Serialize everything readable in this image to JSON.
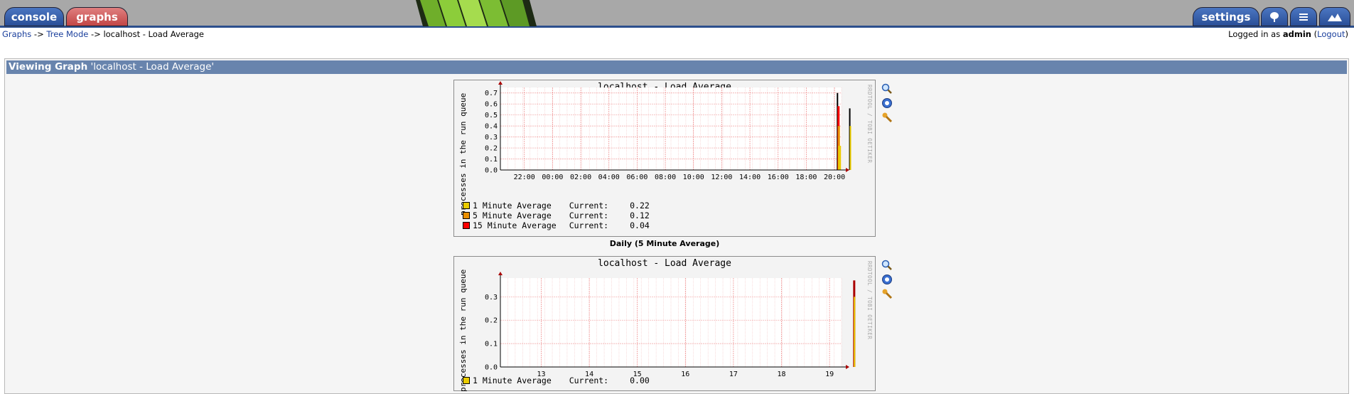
{
  "tabs": {
    "console": "console",
    "graphs": "graphs",
    "settings": "settings"
  },
  "breadcrumb": {
    "link1": "Graphs",
    "sep1": " -> ",
    "link2": "Tree Mode",
    "sep2": " -> ",
    "current": "localhost - Load Average"
  },
  "login": {
    "prefix": "Logged in as ",
    "user": "admin",
    "logout": "Logout"
  },
  "panel": {
    "heading_bold": "Viewing Graph",
    "heading_name": " 'localhost - Load Average'"
  },
  "graphs": [
    {
      "title": "localhost - Load Average",
      "ylabel": "processes in the run queue",
      "rrd": "RRDTOOL / TOBI OETIKER",
      "caption": "Daily (5 Minute Average)",
      "legend": [
        {
          "name": "1 Minute Average ",
          "label": "Current:",
          "value": "0.22",
          "color": "#eacc00"
        },
        {
          "name": "5 Minute Average ",
          "label": "Current:",
          "value": "0.12",
          "color": "#ea8f00"
        },
        {
          "name": "15 Minute Average",
          "label": "Current:",
          "value": "0.04",
          "color": "#ff0000"
        }
      ],
      "chart_data": {
        "type": "area",
        "title": "localhost - Load Average",
        "ylabel": "processes in the run queue",
        "x_ticks": [
          "22:00",
          "00:00",
          "02:00",
          "04:00",
          "06:00",
          "08:00",
          "10:00",
          "12:00",
          "14:00",
          "16:00",
          "18:00",
          "20:00"
        ],
        "y_ticks": [
          "0.0",
          "0.1",
          "0.2",
          "0.3",
          "0.4",
          "0.5",
          "0.6",
          "0.7"
        ],
        "ylim": [
          0,
          0.75
        ]
      }
    },
    {
      "title": "localhost - Load Average",
      "ylabel": "processes in the run queue",
      "rrd": "RRDTOOL / TOBI OETIKER",
      "legend": [
        {
          "name": "1 Minute Average ",
          "label": "Current:",
          "value": "0.00",
          "color": "#eacc00"
        }
      ],
      "chart_data": {
        "type": "area",
        "title": "localhost - Load Average",
        "ylabel": "processes in the run queue",
        "x_ticks": [
          "13",
          "14",
          "15",
          "16",
          "17",
          "18",
          "19"
        ],
        "y_ticks": [
          "0.0",
          "0.1",
          "0.2",
          "0.3"
        ],
        "ylim": [
          0,
          0.38
        ]
      }
    }
  ]
}
